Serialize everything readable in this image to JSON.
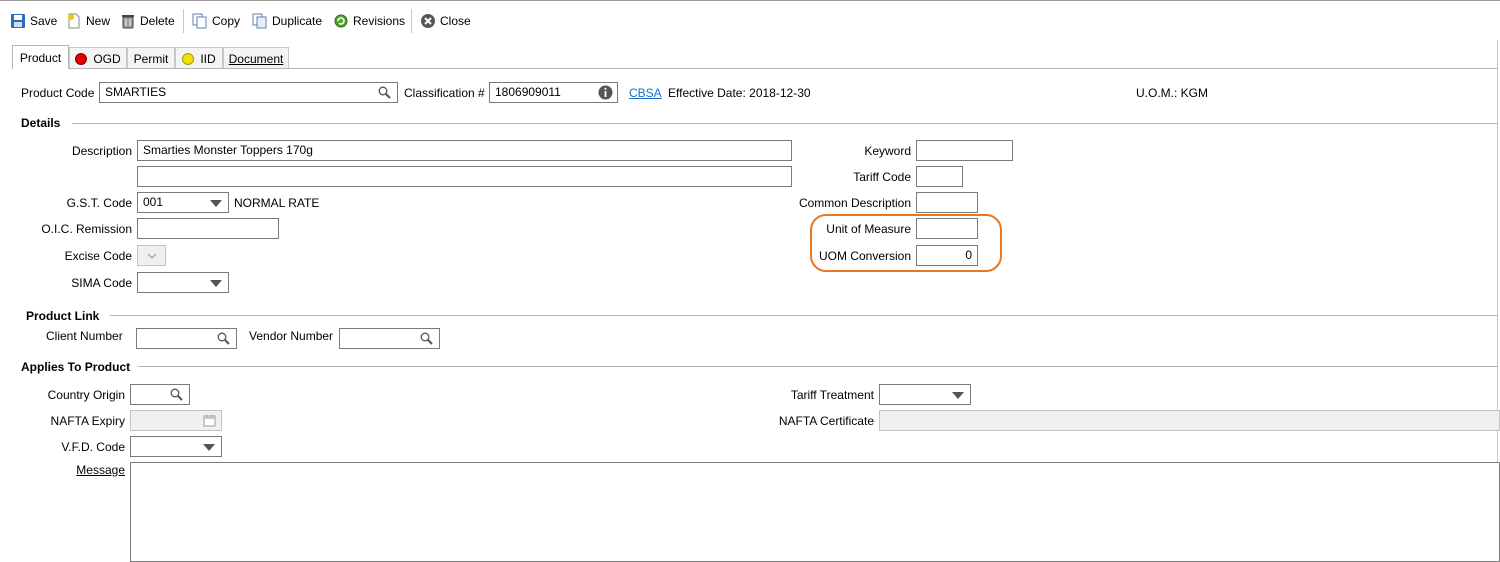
{
  "toolbar": {
    "save": "Save",
    "new": "New",
    "delete": "Delete",
    "copy": "Copy",
    "duplicate": "Duplicate",
    "revisions": "Revisions",
    "close": "Close"
  },
  "tabs": {
    "product": "Product",
    "ogd": "OGD",
    "permit": "Permit",
    "iid": "IID",
    "document": "Document"
  },
  "header": {
    "product_code_label": "Product Code",
    "product_code_value": "SMARTIES",
    "classification_label": "Classification #",
    "classification_value": "1806909011",
    "cbsa_link": "CBSA",
    "effective_date": "Effective Date: 2018-12-30",
    "uom": "U.O.M.: KGM"
  },
  "details": {
    "section_title": "Details",
    "description_label": "Description",
    "description_value": "Smarties Monster Toppers 170g",
    "description2_value": "",
    "gst_label": "G.S.T. Code",
    "gst_value": "001",
    "gst_rate_text": "NORMAL RATE",
    "oic_label": "O.I.C. Remission",
    "oic_value": "",
    "excise_label": "Excise Code",
    "sima_label": "SIMA Code",
    "keyword_label": "Keyword",
    "keyword_value": "",
    "tariff_code_label": "Tariff Code",
    "tariff_code_value": "",
    "common_desc_label": "Common Description",
    "common_desc_value": "",
    "uom_label": "Unit of Measure",
    "uom_value": "",
    "uom_conv_label": "UOM Conversion",
    "uom_conv_value": "0"
  },
  "product_link": {
    "section_title": "Product Link",
    "client_number_label": "Client Number",
    "vendor_number_label": "Vendor Number"
  },
  "applies": {
    "section_title": "Applies To Product",
    "country_origin_label": "Country Origin",
    "nafta_expiry_label": "NAFTA Expiry",
    "vfd_code_label": "V.F.D. Code",
    "message_label": "Message",
    "tariff_treatment_label": "Tariff Treatment",
    "nafta_certificate_label": "NAFTA Certificate"
  },
  "colors": {
    "highlight": "#e87722",
    "ogd_dot": "#e00000",
    "iid_dot": "#f2e200",
    "link": "#1a6fc6"
  }
}
